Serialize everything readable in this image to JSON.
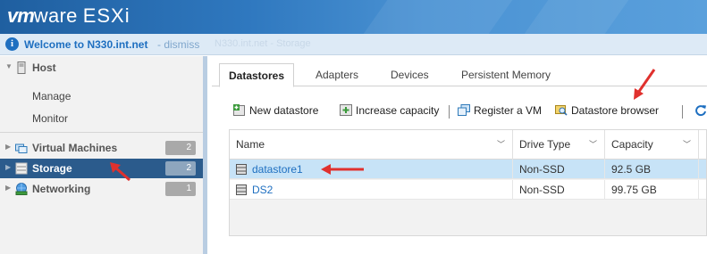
{
  "header": {
    "logo_vm": "vm",
    "logo_ware": "ware",
    "logo_product": "ESXi",
    "gradient_start": "#1f5fa0",
    "gradient_end": "#5aa0dc"
  },
  "notification": {
    "icon": "info-icon",
    "welcome": "Welcome to N330.int.net",
    "dismiss": " - dismiss",
    "ghost_breadcrumb": "N330.int.net - Storage"
  },
  "sidebar": {
    "host": {
      "label": "Host",
      "icon": "server-icon"
    },
    "host_children": [
      {
        "label": "Manage"
      },
      {
        "label": "Monitor"
      }
    ],
    "items": [
      {
        "label": "Virtual Machines",
        "badge": "2",
        "icon": "vm-icon"
      },
      {
        "label": "Storage",
        "badge": "2",
        "icon": "storage-icon",
        "selected": true
      },
      {
        "label": "Networking",
        "badge": "1",
        "icon": "network-icon"
      }
    ],
    "selected_color": "#2b5b8c"
  },
  "tabs": [
    {
      "label": "Datastores",
      "active": true
    },
    {
      "label": "Adapters"
    },
    {
      "label": "Devices"
    },
    {
      "label": "Persistent Memory"
    }
  ],
  "toolbar": {
    "new_datastore": "New datastore",
    "increase_capacity": "Increase capacity",
    "register_vm": "Register a VM",
    "datastore_browser": "Datastore browser"
  },
  "grid": {
    "columns": [
      "Name",
      "Drive Type",
      "Capacity"
    ],
    "rows": [
      {
        "name": "datastore1",
        "drive_type": "Non-SSD",
        "capacity": "92.5 GB",
        "selected": true
      },
      {
        "name": "DS2",
        "drive_type": "Non-SSD",
        "capacity": "99.75 GB"
      }
    ],
    "selected_row_color": "#c7e3f7"
  },
  "annotation_color": "#e0312e"
}
